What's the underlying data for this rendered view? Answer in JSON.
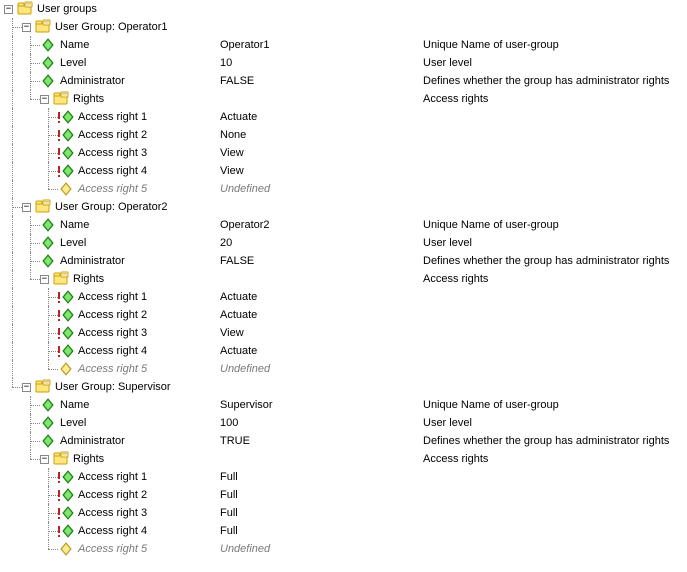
{
  "root": {
    "label": "User groups"
  },
  "groups": [
    {
      "header": "User Group: Operator1",
      "name": {
        "label": "Name",
        "value": "Operator1",
        "desc": "Unique Name of user-group"
      },
      "level": {
        "label": "Level",
        "value": "10",
        "desc": "User level"
      },
      "admin": {
        "label": "Administrator",
        "value": "FALSE",
        "desc": "Defines whether the group has administrator rights"
      },
      "rights": {
        "label": "Rights",
        "desc": "Access rights",
        "items": [
          {
            "label": "Access right 1",
            "value": "Actuate",
            "undef": false
          },
          {
            "label": "Access right 2",
            "value": "None",
            "undef": false
          },
          {
            "label": "Access right 3",
            "value": "View",
            "undef": false
          },
          {
            "label": "Access right 4",
            "value": "View",
            "undef": false
          },
          {
            "label": "Access right 5",
            "value": "Undefined",
            "undef": true
          }
        ]
      }
    },
    {
      "header": "User Group: Operator2",
      "name": {
        "label": "Name",
        "value": "Operator2",
        "desc": "Unique Name of user-group"
      },
      "level": {
        "label": "Level",
        "value": "20",
        "desc": "User level"
      },
      "admin": {
        "label": "Administrator",
        "value": "FALSE",
        "desc": "Defines whether the group has administrator rights"
      },
      "rights": {
        "label": "Rights",
        "desc": "Access rights",
        "items": [
          {
            "label": "Access right 1",
            "value": "Actuate",
            "undef": false
          },
          {
            "label": "Access right 2",
            "value": "Actuate",
            "undef": false
          },
          {
            "label": "Access right 3",
            "value": "View",
            "undef": false
          },
          {
            "label": "Access right 4",
            "value": "Actuate",
            "undef": false
          },
          {
            "label": "Access right 5",
            "value": "Undefined",
            "undef": true
          }
        ]
      }
    },
    {
      "header": "User Group: Supervisor",
      "name": {
        "label": "Name",
        "value": "Supervisor",
        "desc": "Unique Name of user-group"
      },
      "level": {
        "label": "Level",
        "value": "100",
        "desc": "User level"
      },
      "admin": {
        "label": "Administrator",
        "value": "TRUE",
        "desc": "Defines whether the group has administrator rights"
      },
      "rights": {
        "label": "Rights",
        "desc": "Access rights",
        "items": [
          {
            "label": "Access right 1",
            "value": "Full",
            "undef": false
          },
          {
            "label": "Access right 2",
            "value": "Full",
            "undef": false
          },
          {
            "label": "Access right 3",
            "value": "Full",
            "undef": false
          },
          {
            "label": "Access right 4",
            "value": "Full",
            "undef": false
          },
          {
            "label": "Access right 5",
            "value": "Undefined",
            "undef": true
          }
        ]
      }
    }
  ]
}
